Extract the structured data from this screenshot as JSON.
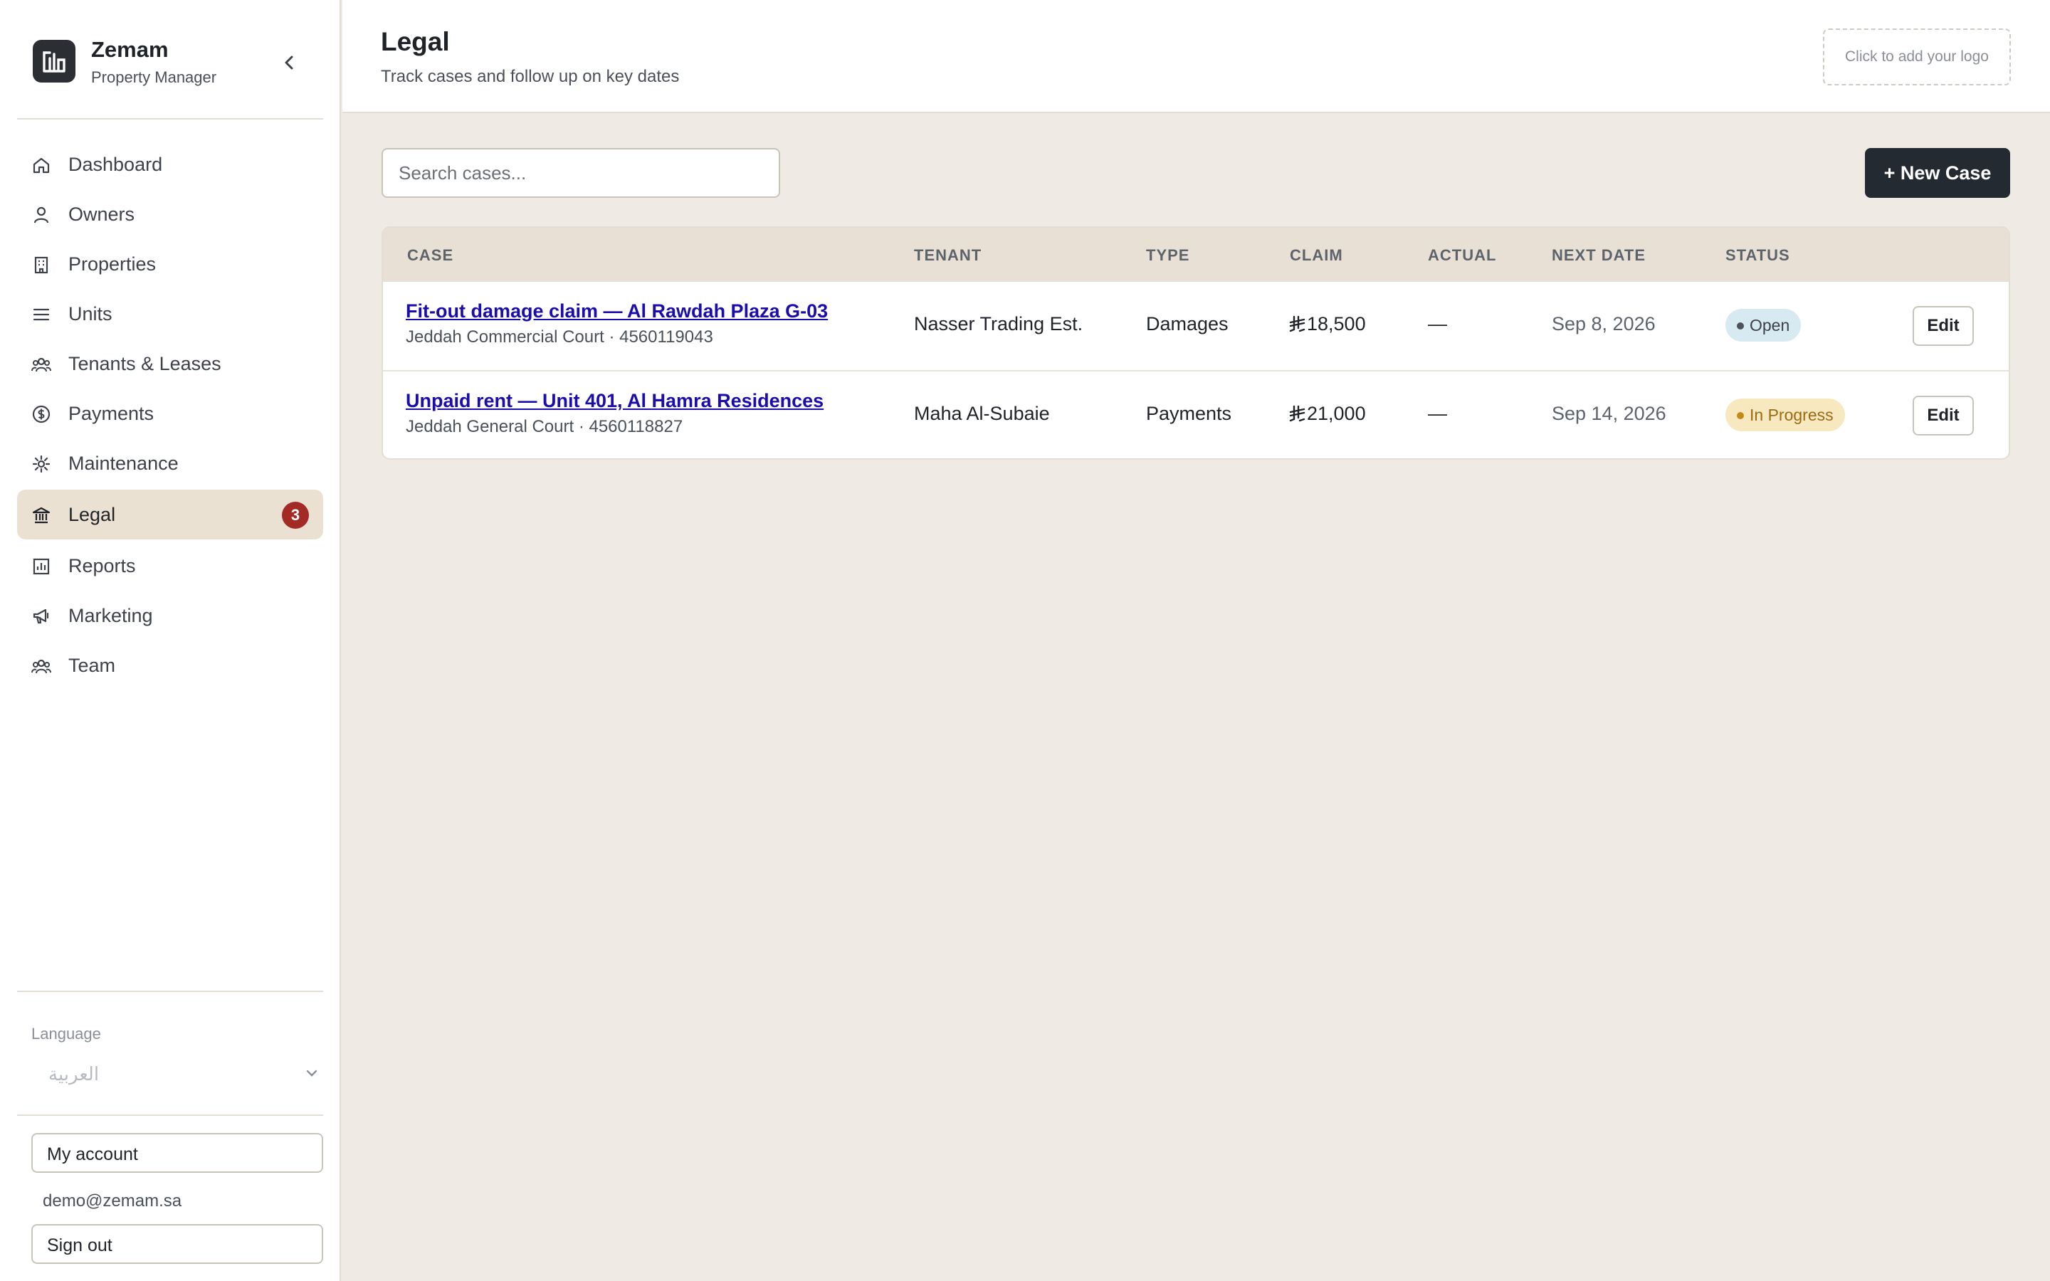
{
  "app": {
    "name": "Zemam",
    "subtitle": "Property Manager"
  },
  "sidebar": {
    "items": [
      {
        "label": "Dashboard",
        "icon": "home-icon"
      },
      {
        "label": "Owners",
        "icon": "user-icon"
      },
      {
        "label": "Properties",
        "icon": "building-icon"
      },
      {
        "label": "Units",
        "icon": "list-icon"
      },
      {
        "label": "Tenants & Leases",
        "icon": "users-icon"
      },
      {
        "label": "Payments",
        "icon": "dollar-circle-icon"
      },
      {
        "label": "Maintenance",
        "icon": "gear-icon"
      },
      {
        "label": "Legal",
        "icon": "bank-icon",
        "active": true,
        "badge": "3"
      },
      {
        "label": "Reports",
        "icon": "bar-chart-icon"
      },
      {
        "label": "Marketing",
        "icon": "megaphone-icon"
      },
      {
        "label": "Team",
        "icon": "team-icon"
      }
    ],
    "language_label": "Language",
    "language_value": "العربية",
    "account_label": "My account",
    "user_email": "demo@zemam.sa",
    "signout_label": "Sign out"
  },
  "header": {
    "title": "Legal",
    "subtitle": "Track cases and follow up on key dates",
    "logo_placeholder": "Click to add your logo"
  },
  "toolbar": {
    "search_placeholder": "Search cases...",
    "new_case_label": "+ New Case"
  },
  "table": {
    "columns": [
      "CASE",
      "TENANT",
      "TYPE",
      "CLAIM",
      "ACTUAL",
      "NEXT DATE",
      "STATUS"
    ],
    "rows": [
      {
        "title": "Fit-out damage claim — Al Rawdah Plaza G-03",
        "meta": "Jeddah Commercial Court · 4560119043",
        "tenant": "Nasser Trading Est.",
        "type": "Damages",
        "claim": "18,500",
        "actual": "—",
        "next_date": "Sep 8, 2026",
        "status": "Open",
        "action": "Edit"
      },
      {
        "title": "Unpaid rent — Unit 401, Al Hamra Residences",
        "meta": "Jeddah General Court · 4560118827",
        "tenant": "Maha Al-Subaie",
        "type": "Payments",
        "claim": "21,000",
        "actual": "—",
        "next_date": "Sep 14, 2026",
        "status": "In Progress",
        "action": "Edit"
      }
    ]
  },
  "colors": {
    "accent_dark": "#232a31",
    "active_nav_bg": "#ebe1d3",
    "badge_red": "#a42a25",
    "link_blue": "#1a0dab",
    "status_open_bg": "#d7e9f1",
    "status_progress_bg": "#f7e8bf"
  }
}
